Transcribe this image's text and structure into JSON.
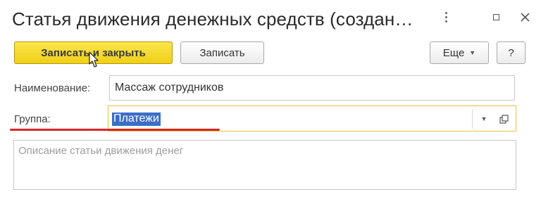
{
  "window": {
    "title": "Статья движения денежных средств (создан…",
    "controls": [
      "more-options",
      "maximize",
      "close"
    ]
  },
  "toolbar": {
    "save_close_label": "Записать и закрыть",
    "save_label": "Записать",
    "more_label": "Еще",
    "help_label": "?"
  },
  "form": {
    "name_label": "Наименование:",
    "name_value": "Массаж сотрудников",
    "group_label": "Группа:",
    "group_value": "Платежи",
    "description_placeholder": "Описание статьи движения денег"
  },
  "colors": {
    "primary_button": "#efcf18",
    "selection": "#3b6ec6",
    "annotation_underline": "#d8262a",
    "focused_field_border": "#e0c440"
  }
}
